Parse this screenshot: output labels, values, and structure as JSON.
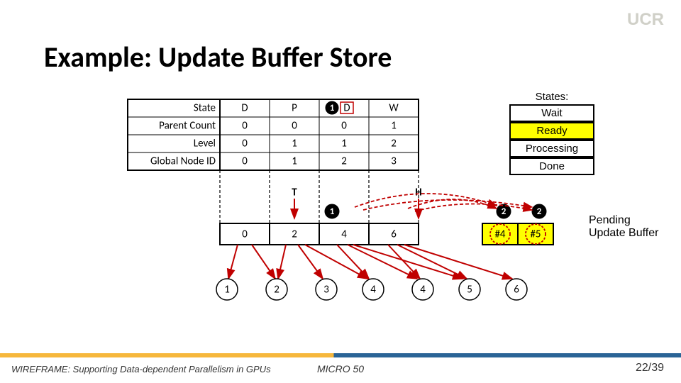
{
  "title": "Example: Update Buffer Store",
  "logo": "UCR",
  "footer": {
    "left": "WIREFRAME: Supporting Data-dependent Parallelism in GPUs",
    "mid": "MICRO 50",
    "page": "22/39"
  },
  "states_legend": {
    "title": "States:",
    "wait": "Wait",
    "ready": "Ready",
    "processing": "Processing",
    "done": "Done"
  },
  "table": {
    "rows": [
      "State",
      "Parent Count",
      "Level",
      "Global Node ID"
    ],
    "cols": 4,
    "data": [
      [
        "D",
        "P",
        "D",
        "W"
      ],
      [
        "0",
        "0",
        "0",
        "1"
      ],
      [
        "0",
        "1",
        "1",
        "2"
      ],
      [
        "0",
        "1",
        "2",
        "3"
      ]
    ],
    "badge_col2": "1"
  },
  "tpointer": "T",
  "hpointer": "H",
  "badges_above_buffer": {
    "col1": "1",
    "col4": "2",
    "col5": "2"
  },
  "buffer": {
    "cells": [
      "0",
      "2",
      "4",
      "6",
      "#4",
      "#5"
    ],
    "annotated_cols": [
      4,
      5
    ]
  },
  "pending_label": "Pending Update Buffer",
  "bottom_row": [
    "1",
    "2",
    "3",
    "4",
    "4",
    "5",
    "6"
  ]
}
